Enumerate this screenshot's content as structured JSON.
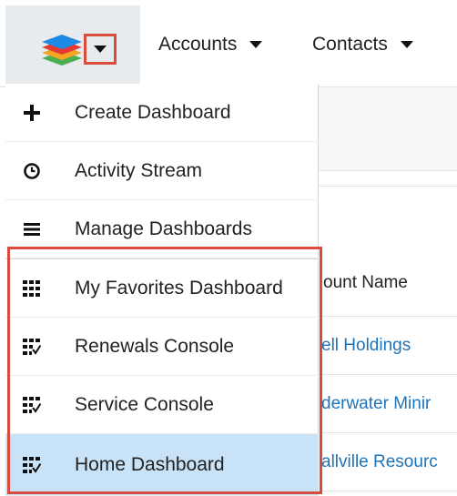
{
  "nav": {
    "logo_icon": "sugar-cube-logo",
    "items": [
      {
        "label": "Accounts"
      },
      {
        "label": "Contacts"
      }
    ]
  },
  "background": {
    "column_header": "ount Name",
    "rows": [
      "ell Holdings",
      "derwater Minir",
      "allville Resourc"
    ]
  },
  "menu": {
    "actions": [
      {
        "label": "Create Dashboard",
        "icon": "plus-icon"
      },
      {
        "label": "Activity Stream",
        "icon": "clock-icon"
      },
      {
        "label": "Manage Dashboards",
        "icon": "menu-lines-icon"
      }
    ],
    "dashboards": [
      {
        "label": "My Favorites Dashboard",
        "icon": "grid-icon"
      },
      {
        "label": "Renewals Console",
        "icon": "grid-check-icon"
      },
      {
        "label": "Service Console",
        "icon": "grid-check-icon"
      },
      {
        "label": "Home Dashboard",
        "icon": "grid-check-icon",
        "selected": true
      }
    ]
  },
  "colors": {
    "highlight": "#d94c3d",
    "link": "#1f73b7",
    "selected_bg": "#c8e3f7"
  }
}
